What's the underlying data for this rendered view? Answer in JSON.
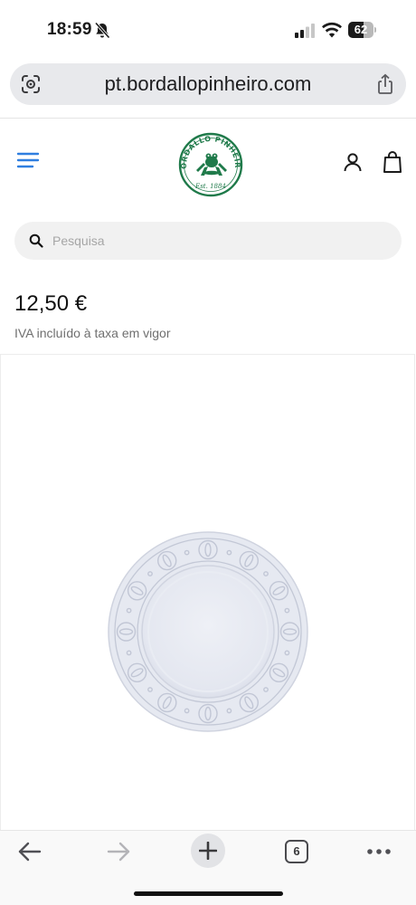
{
  "status_bar": {
    "time": "18:59",
    "battery_percent": "62",
    "battery_level": 0.62,
    "icons": [
      "bell-slash-icon",
      "cellular-signal-icon",
      "wifi-icon",
      "battery-icon"
    ]
  },
  "browser": {
    "url": "pt.bordallopinheiro.com",
    "icons": [
      "visual-lookup-icon",
      "share-icon"
    ],
    "toolbar": {
      "tab_count": "6",
      "icons": [
        "back-arrow-icon",
        "forward-arrow-icon",
        "plus-icon",
        "tabs-icon",
        "more-dots-icon"
      ]
    }
  },
  "site_header": {
    "logo": {
      "brand_text": "BORDALLO PINHEIRO",
      "est_text": "Est. 1884",
      "color": "#1f7a4a"
    },
    "icons": [
      "hamburger-menu-icon",
      "account-icon",
      "shopping-bag-icon"
    ],
    "accent_color": "#2f7fe0"
  },
  "search": {
    "placeholder": "Pesquisa",
    "value": ""
  },
  "product": {
    "price": "12,50 €",
    "tax_note": "IVA incluído à taxa em vigor",
    "image": "white-embossed-plate"
  }
}
